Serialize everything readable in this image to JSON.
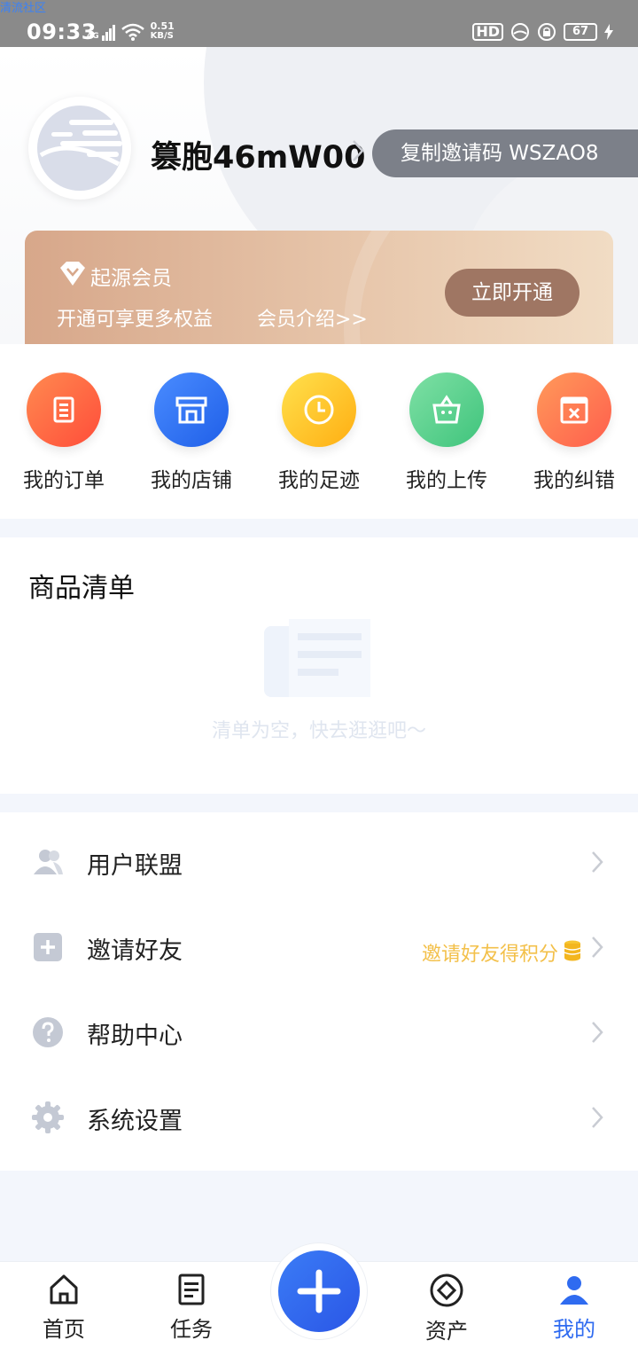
{
  "status_bar": {
    "watermark": "清流社区",
    "time": "09:33",
    "network": "4G",
    "speed_value": "0.51",
    "speed_unit": "KB/S",
    "battery": "67"
  },
  "profile": {
    "username": "篡胞46mW00",
    "invite_label": "复制邀请码 WSZAO8"
  },
  "vip": {
    "title": "起源会员",
    "subtitle": "开通可享更多权益",
    "intro_link": "会员介绍>>",
    "button": "立即开通"
  },
  "shortcuts": [
    {
      "label": "我的订单",
      "icon": "order-icon",
      "color": "#ff6a3d"
    },
    {
      "label": "我的店铺",
      "icon": "store-icon",
      "color": "#2f6bf0"
    },
    {
      "label": "我的足迹",
      "icon": "clock-icon",
      "color": "#ffc21a"
    },
    {
      "label": "我的上传",
      "icon": "bag-icon",
      "color": "#5fd08e"
    },
    {
      "label": "我的纠错",
      "icon": "error-calendar-icon",
      "color": "#ff7a4d"
    }
  ],
  "goods": {
    "title": "商品清单",
    "empty_text": "清单为空，快去逛逛吧～"
  },
  "menu": [
    {
      "label": "用户联盟",
      "icon": "users-icon"
    },
    {
      "label": "邀请好友",
      "icon": "plus-square-icon",
      "extra": "邀请好友得积分"
    },
    {
      "label": "帮助中心",
      "icon": "help-icon"
    },
    {
      "label": "系统设置",
      "icon": "gear-icon"
    }
  ],
  "nav": [
    {
      "label": "首页",
      "icon": "home-icon"
    },
    {
      "label": "任务",
      "icon": "task-icon"
    },
    {
      "label": "",
      "icon": "plus-icon"
    },
    {
      "label": "资产",
      "icon": "asset-icon"
    },
    {
      "label": "我的",
      "icon": "user-icon",
      "active": true
    }
  ],
  "colors": {
    "accent": "#2f6bf0",
    "gold": "#f3c04a",
    "vip_button": "#9f7663"
  }
}
